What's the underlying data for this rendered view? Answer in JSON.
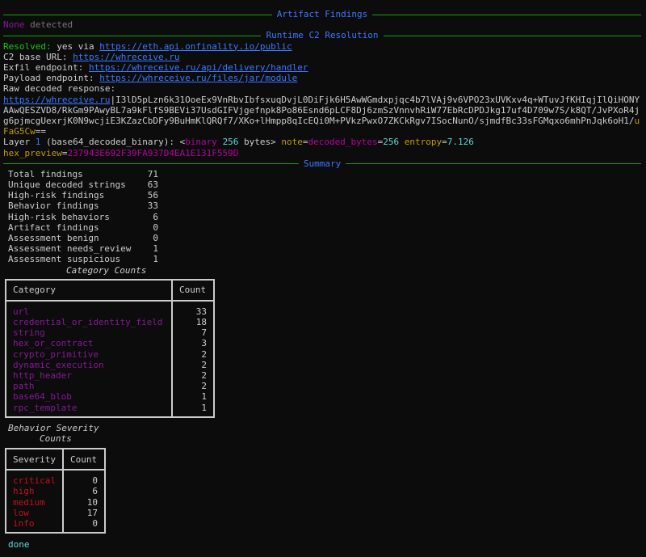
{
  "sections": {
    "artifact_findings": "Artifact Findings",
    "runtime_c2": "Runtime C2 Resolution",
    "summary": "Summary"
  },
  "artifact": {
    "none_label": "None",
    "detected": " detected"
  },
  "resolved": {
    "label": "Resolved:",
    "prefix": " yes via ",
    "url": "https://eth.api.onfinality.io/public"
  },
  "c2": {
    "base_label": "C2 base URL: ",
    "base_url": "https://whreceive.ru",
    "exfil_label": "Exfil endpoint: ",
    "exfil_url": "https://whreceive.ru/api/delivery/handler",
    "payload_label": "Payload endpoint: ",
    "payload_url": "https://whreceive.ru/files/jar/module",
    "raw_label": "Raw decoded response:",
    "raw_url": "https://whreceive.ru",
    "raw_body": "I3lD5pLzn6k31OoeEx9VnRbvIbfsxuqDvjL0DiFjk6H5AwWGmdxpjqc4b7lVAj9v6VPO23xUVKxv4q+WTuvJfKHIqjIlQiHONYAAwQESZVD8/RkGm9PAwyBL7a9kFlfS9BEVi37UsdGIFVjgefnpk8Po86Esnd6pLCF8Dj6zmSzVnnvhRiW77EbRcDPDJkg17uf4D709w7S/k8QT/JvPXoR4jg6pjmcgUexrjK0N9wcjiE3KZazCbDFy9BuHmKlQRQf7/XKo+lHmpp8qIcEQi0M+PVkzPwxO7ZKCkRgv7ISocNunO/sjmdfBc33sFGMqxo6mhPnJqk6oH1/",
    "raw_tail": "uFaG5Cw",
    "raw_end": "=="
  },
  "layer": {
    "prefix": "Layer ",
    "num": "1",
    "desc": " (base64_decoded_binary): <",
    "binary": "binary",
    "space": " ",
    "bytes_num": "256",
    "bytes_word": " bytes> ",
    "note_label": "note",
    "eq": "=",
    "note_val": "decoded_bytes",
    "eq2": "=",
    "note_num": "256",
    "entropy_label": " entropy",
    "eq3": "=",
    "entropy_val": "7.126",
    "hex_label": "hex_preview",
    "eq4": "=",
    "hex_val": "237943E692F39FA937D4EA1E131F559D"
  },
  "summary": [
    {
      "label": "Total findings",
      "value": "71"
    },
    {
      "label": "Unique decoded strings",
      "value": "63"
    },
    {
      "label": "High-risk findings",
      "value": "56"
    },
    {
      "label": "Behavior findings",
      "value": "33"
    },
    {
      "label": "High-risk behaviors",
      "value": "6"
    },
    {
      "label": "Artifact findings",
      "value": "0"
    },
    {
      "label": "Assessment benign",
      "value": "0"
    },
    {
      "label": "Assessment needs_review",
      "value": "1"
    },
    {
      "label": "Assessment suspicious",
      "value": "1"
    }
  ],
  "category_table": {
    "caption": "Category Counts",
    "col1": "Category",
    "col2": "Count",
    "rows": [
      {
        "name": "url",
        "count": "33"
      },
      {
        "name": "credential_or_identity_field",
        "count": "18"
      },
      {
        "name": "string",
        "count": "7"
      },
      {
        "name": "hex_or_contract",
        "count": "3"
      },
      {
        "name": "crypto_primitive",
        "count": "2"
      },
      {
        "name": "dynamic_execution",
        "count": "2"
      },
      {
        "name": "http_header",
        "count": "2"
      },
      {
        "name": "path",
        "count": "2"
      },
      {
        "name": "base64_blob",
        "count": "1"
      },
      {
        "name": "rpc_template",
        "count": "1"
      }
    ]
  },
  "severity_table": {
    "caption_line1": "Behavior Severity",
    "caption_line2": "Counts",
    "col1": "Severity",
    "col2": "Count",
    "rows": [
      {
        "name": "critical",
        "count": "0"
      },
      {
        "name": "high",
        "count": "6"
      },
      {
        "name": "medium",
        "count": "10"
      },
      {
        "name": "low",
        "count": "17"
      },
      {
        "name": "info",
        "count": "0"
      }
    ]
  },
  "status": "done",
  "colors": {
    "background": "#0c0c0c",
    "rule_green": "#13a10e",
    "heading_blue": "#3b78ff",
    "category_purple": "#881798",
    "severity_red": "#c50f1f",
    "done_cyan": "#61d6d6",
    "highlight_yellow": "#c19c00"
  }
}
